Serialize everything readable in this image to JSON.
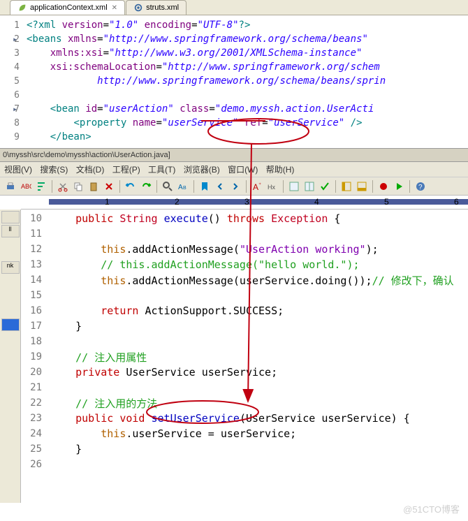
{
  "tabs": {
    "active": "applicationContext.xml",
    "inactive": "struts.xml"
  },
  "xml": {
    "lines": [
      "1",
      "2",
      "3",
      "4",
      "5",
      "6",
      "7",
      "8",
      "9"
    ],
    "l1": "<?xml version=\"1.0\" encoding=\"UTF-8\"?>",
    "l2_a": "<beans ",
    "l2_b": "xmlns",
    "l2_c": "=",
    "l2_d": "\"http://www.springframework.org/schema/beans\"",
    "l3_a": "xmlns:xsi",
    "l3_b": "=",
    "l3_c": "\"http://www.w3.org/2001/XMLSchema-instance\"",
    "l4_a": "xsi:schemaLocation",
    "l4_b": "=",
    "l4_c": "\"http://www.springframework.org/schem",
    "l5": "http://www.springframework.org/schema/beans/sprin",
    "l7_a": "<bean ",
    "l7_b": "id",
    "l7_c": "=",
    "l7_d": "\"userAction\"",
    "l7_e": " class",
    "l7_f": "=",
    "l7_g": "\"demo.myssh.action.UserActi",
    "l8_a": "<property ",
    "l8_b": "name",
    "l8_c": "=",
    "l8_d": "\"userService\"",
    "l8_e": " ref",
    "l8_f": "=",
    "l8_g": "\"userService\"",
    "l8_h": " />",
    "l9": "</bean>"
  },
  "path": "0\\myssh\\src\\demo\\myssh\\action\\UserAction.java]",
  "menus": [
    "视图(V)",
    "搜索(S)",
    "文档(D)",
    "工程(P)",
    "工具(T)",
    "浏览器(B)",
    "窗口(W)",
    "帮助(H)"
  ],
  "ruler_nums": [
    "1",
    "2",
    "3",
    "4",
    "5",
    "6"
  ],
  "side_items": [
    "",
    "ll",
    "",
    "nk",
    ""
  ],
  "java": {
    "lines": [
      "10",
      "11",
      "12",
      "13",
      "14",
      "15",
      "16",
      "17",
      "18",
      "19",
      "20",
      "21",
      "22",
      "23",
      "24",
      "25",
      "26"
    ],
    "l10_a": "public",
    "l10_b": " String ",
    "l10_c": "execute",
    "l10_d": "() ",
    "l10_e": "throws",
    "l10_f": " Exception ",
    "l10_g": "{",
    "l12_a": "this",
    "l12_b": ".addActionMessage(",
    "l12_c": "\"UserAction working\"",
    "l12_d": ");",
    "l13_a": "// this.addActionMessage(\"hello world.\");",
    "l14_a": "this",
    "l14_b": ".addActionMessage(userService.doing());",
    "l14_c": "// 修改下，确认",
    "l16_a": "return",
    "l16_b": " ActionSupport.SUCCESS;",
    "l17": "}",
    "l19": "// 注入用属性",
    "l20_a": "private",
    "l20_b": " UserService userService;",
    "l22": "// 注入用的方法",
    "l23_a": "public",
    "l23_b": " void ",
    "l23_c": "setUserService",
    "l23_d": "(UserService userService) {",
    "l24_a": "this",
    "l24_b": ".userService = userService;",
    "l25": "}"
  },
  "watermark": "@51CTO博客"
}
